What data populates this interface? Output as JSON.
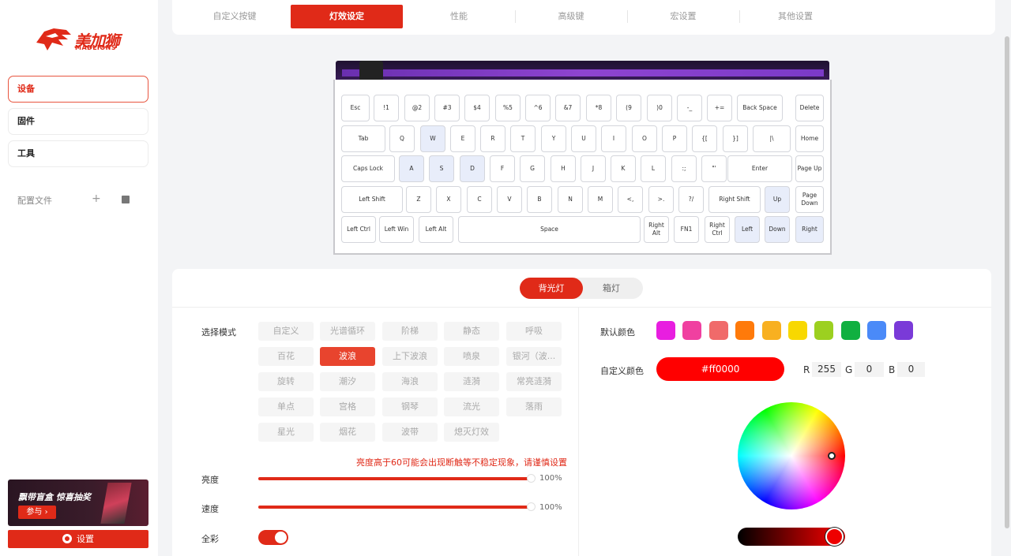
{
  "logo": {
    "text": "美加狮",
    "sub": "MADLIONS"
  },
  "sidebar": {
    "items": [
      {
        "label": "设备",
        "active": true
      },
      {
        "label": "固件",
        "active": false
      },
      {
        "label": "工具",
        "active": false
      }
    ],
    "profile_label": "配置文件",
    "add": "+",
    "banner": {
      "title": "飘带盲盒 惊喜抽奖",
      "button": "参与 ›"
    },
    "settings": "设置"
  },
  "tabs": [
    {
      "label": "自定义按键"
    },
    {
      "label": "灯效设定",
      "active": true
    },
    {
      "label": "性能"
    },
    {
      "label": "高级键"
    },
    {
      "label": "宏设置"
    },
    {
      "label": "其他设置"
    }
  ],
  "keyboard": {
    "rows": [
      [
        [
          "Esc",
          0
        ],
        [
          "!1",
          0
        ],
        [
          "@2",
          0
        ],
        [
          "#3",
          0
        ],
        [
          "$4",
          0
        ],
        [
          "%5",
          0
        ],
        [
          "^6",
          0
        ],
        [
          "&7",
          0
        ],
        [
          "*8",
          0
        ],
        [
          "(9",
          0
        ],
        [
          ")0",
          0
        ],
        [
          "-_",
          0
        ],
        [
          "+=",
          0
        ],
        [
          "Back Space",
          0
        ],
        [
          "Delete",
          0
        ]
      ],
      [
        [
          "Tab",
          0
        ],
        [
          "Q",
          0
        ],
        [
          "W",
          1
        ],
        [
          "E",
          0
        ],
        [
          "R",
          0
        ],
        [
          "T",
          0
        ],
        [
          "Y",
          0
        ],
        [
          "U",
          0
        ],
        [
          "I",
          0
        ],
        [
          "O",
          0
        ],
        [
          "P",
          0
        ],
        [
          "{[",
          0
        ],
        [
          "}]",
          0
        ],
        [
          "|\\",
          0
        ],
        [
          "Home",
          0
        ]
      ],
      [
        [
          "Caps Lock",
          0
        ],
        [
          "A",
          1
        ],
        [
          "S",
          1
        ],
        [
          "D",
          1
        ],
        [
          "F",
          0
        ],
        [
          "G",
          0
        ],
        [
          "H",
          0
        ],
        [
          "J",
          0
        ],
        [
          "K",
          0
        ],
        [
          "L",
          0
        ],
        [
          ":;",
          0
        ],
        [
          "\"'",
          0
        ],
        [
          "Enter",
          0
        ],
        [
          "Page Up",
          0
        ]
      ],
      [
        [
          "Left Shift",
          0
        ],
        [
          "Z",
          0
        ],
        [
          "X",
          0
        ],
        [
          "C",
          0
        ],
        [
          "V",
          0
        ],
        [
          "B",
          0
        ],
        [
          "N",
          0
        ],
        [
          "M",
          0
        ],
        [
          "<,",
          0
        ],
        [
          ">.",
          0
        ],
        [
          "?/",
          0
        ],
        [
          "Right Shift",
          0
        ],
        [
          "Up",
          1
        ],
        [
          "Page Down",
          0
        ]
      ],
      [
        [
          "Left Ctrl",
          0
        ],
        [
          "Left Win",
          0
        ],
        [
          "Left Alt",
          0
        ],
        [
          "Space",
          0
        ],
        [
          "Right Alt",
          0
        ],
        [
          "FN1",
          0
        ],
        [
          "Right Ctrl",
          0
        ],
        [
          "Left",
          1
        ],
        [
          "Down",
          1
        ],
        [
          "Right",
          1
        ]
      ]
    ]
  },
  "lighting": {
    "segments": [
      {
        "label": "背光灯",
        "active": true
      },
      {
        "label": "箱灯",
        "active": false
      }
    ],
    "mode_label": "选择模式",
    "modes": [
      "自定义",
      "光谱循环",
      "阶梯",
      "静态",
      "呼吸",
      "百花",
      "波浪",
      "上下波浪",
      "喷泉",
      "银河（波...",
      "旋转",
      "潮汐",
      "海浪",
      "涟漪",
      "常亮涟漪",
      "单点",
      "宫格",
      "钢琴",
      "流光",
      "落雨",
      "星光",
      "烟花",
      "波带",
      "熄灭灯效"
    ],
    "active_mode": "波浪",
    "warning": "亮度高于60可能会出现断触等不稳定现象，请谨慎设置",
    "brightness_label": "亮度",
    "brightness_pct": "100%",
    "speed_label": "速度",
    "speed_pct": "100%",
    "fullcolor_label": "全彩",
    "fullcolor_on": true,
    "default_color_label": "默认颜色",
    "default_colors": [
      "#e81ee0",
      "#f040a0",
      "#f06a6a",
      "#ff7a0a",
      "#f8b020",
      "#f8d800",
      "#9cd020",
      "#10b040",
      "#4a8af8",
      "#7a3ad8"
    ],
    "custom_color_label": "自定义颜色",
    "hex": "#ff0000",
    "r_label": "R",
    "r": "255",
    "g_label": "G",
    "g": "0",
    "b_label": "B",
    "b": "0"
  }
}
